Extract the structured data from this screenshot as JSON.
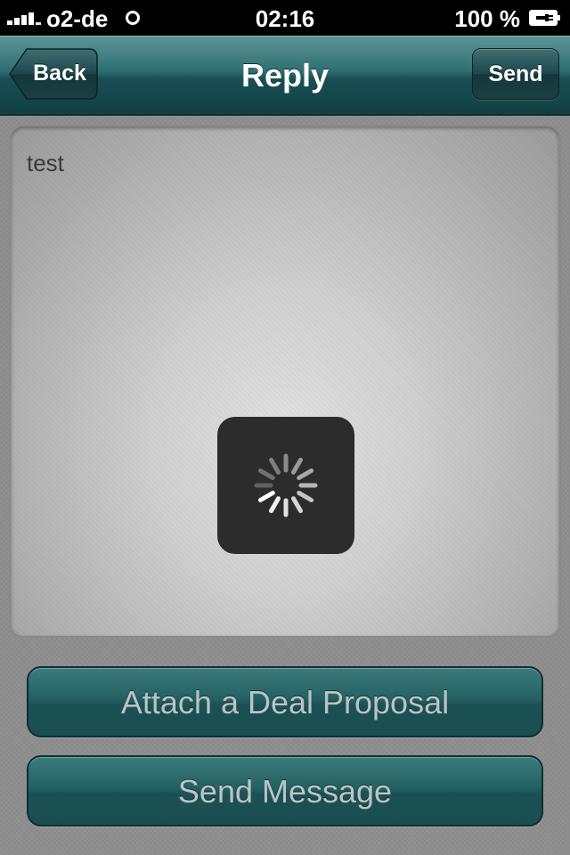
{
  "status_bar": {
    "carrier": "o2-de",
    "time": "02:16",
    "battery": "100 %"
  },
  "nav": {
    "title": "Reply",
    "back_label": "Back",
    "send_label": "Send"
  },
  "message": {
    "text": "test"
  },
  "buttons": {
    "attach_label": "Attach a Deal Proposal",
    "send_message_label": "Send Message"
  },
  "colors": {
    "nav_teal": "#245e62",
    "button_teal": "#246163",
    "button_text": "#b9c4c4",
    "hud_bg": "#2c2c2c"
  },
  "icons": {
    "signal": "signal-bars-icon",
    "wifi": "wifi-icon",
    "battery": "battery-charging-icon",
    "loading": "spinner-icon"
  }
}
